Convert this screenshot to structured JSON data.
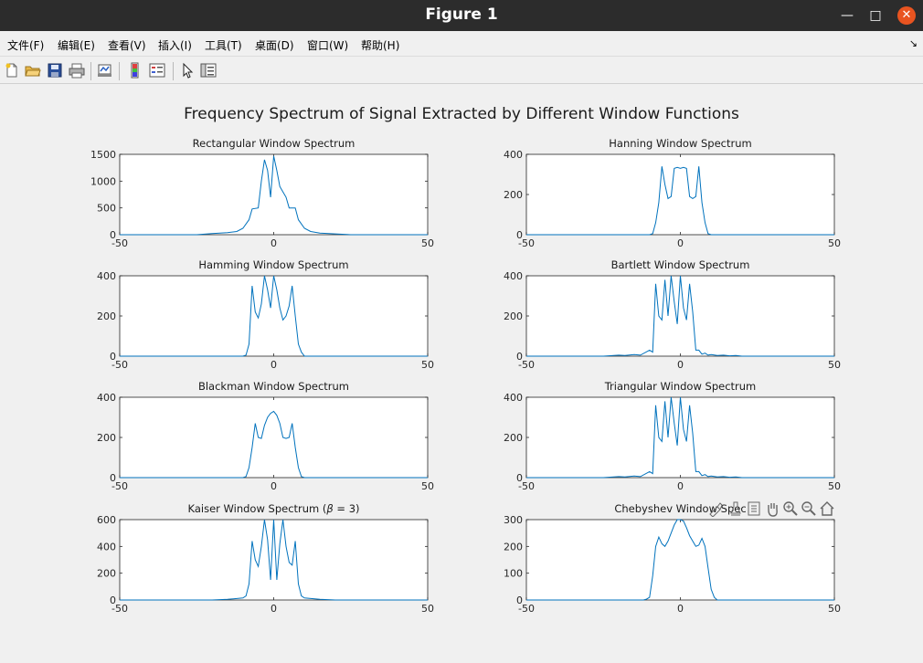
{
  "window": {
    "title": "Figure 1"
  },
  "menu": [
    "文件(F)",
    "编辑(E)",
    "查看(V)",
    "插入(I)",
    "工具(T)",
    "桌面(D)",
    "窗口(W)",
    "帮助(H)"
  ],
  "toolbar": [
    "new-figure-icon",
    "open-file-icon",
    "save-icon",
    "print-icon",
    "link-plot-icon",
    "colorbar-icon",
    "legend-icon",
    "edit-plot-arrow-icon",
    "property-inspector-icon"
  ],
  "axes_toolbar": [
    "brush-icon",
    "data-tips-icon",
    "restore-view-icon",
    "pan-icon",
    "zoom-in-icon",
    "zoom-out-icon",
    "home-icon"
  ],
  "figure": {
    "suptitle": "Frequency Spectrum of Signal Extracted by Different Window Functions",
    "line_color": "#0072bd"
  },
  "chart_data": [
    {
      "type": "line",
      "title": "Rectangular Window Spectrum",
      "xlim": [
        -50,
        50
      ],
      "ylim": [
        0,
        1500
      ],
      "xticks": [
        -50,
        0,
        50
      ],
      "yticks": [
        0,
        500,
        1000,
        1500
      ],
      "x": [
        -50,
        -25,
        -20,
        -15,
        -12,
        -10,
        -8,
        -7,
        -5,
        -4,
        -3,
        -2,
        -1,
        0,
        1,
        2,
        3,
        4,
        5,
        7,
        8,
        10,
        12,
        15,
        20,
        25,
        50
      ],
      "y": [
        0,
        0,
        20,
        40,
        60,
        120,
        280,
        480,
        500,
        1000,
        1400,
        1200,
        700,
        1470,
        1200,
        900,
        800,
        700,
        500,
        500,
        280,
        120,
        60,
        30,
        15,
        0,
        0
      ]
    },
    {
      "type": "line",
      "title": "Hanning Window Spectrum",
      "xlim": [
        -50,
        50
      ],
      "ylim": [
        0,
        400
      ],
      "xticks": [
        -50,
        0,
        50
      ],
      "yticks": [
        0,
        200,
        400
      ],
      "x": [
        -50,
        -10,
        -9,
        -8,
        -7,
        -6,
        -5,
        -4,
        -3,
        -2,
        -1,
        0,
        1,
        2,
        3,
        4,
        5,
        6,
        7,
        8,
        9,
        10,
        50
      ],
      "y": [
        0,
        0,
        5,
        60,
        160,
        340,
        250,
        180,
        190,
        330,
        335,
        330,
        335,
        330,
        190,
        180,
        190,
        340,
        160,
        60,
        5,
        0,
        0
      ]
    },
    {
      "type": "line",
      "title": "Hamming Window Spectrum",
      "xlim": [
        -50,
        50
      ],
      "ylim": [
        0,
        400
      ],
      "xticks": [
        -50,
        0,
        50
      ],
      "yticks": [
        0,
        200,
        400
      ],
      "x": [
        -50,
        -10,
        -9,
        -8,
        -7,
        -6,
        -5,
        -4,
        -3,
        -2,
        -1,
        0,
        1,
        2,
        3,
        4,
        5,
        6,
        7,
        8,
        9,
        10,
        50
      ],
      "y": [
        0,
        0,
        5,
        60,
        350,
        220,
        190,
        260,
        400,
        330,
        240,
        410,
        330,
        240,
        180,
        200,
        250,
        350,
        200,
        60,
        20,
        0,
        0
      ]
    },
    {
      "type": "line",
      "title": "Bartlett Window Spectrum",
      "xlim": [
        -50,
        50
      ],
      "ylim": [
        0,
        400
      ],
      "xticks": [
        -50,
        0,
        50
      ],
      "yticks": [
        0,
        200,
        400
      ],
      "x": [
        -50,
        -25,
        -20,
        -18,
        -15,
        -13,
        -10,
        -9,
        -8,
        -7,
        -6,
        -5,
        -4,
        -3,
        -2,
        -1,
        0,
        1,
        2,
        3,
        4,
        5,
        6,
        7,
        8,
        9,
        10,
        12,
        14,
        16,
        18,
        20,
        50
      ],
      "y": [
        0,
        0,
        5,
        3,
        8,
        5,
        30,
        20,
        360,
        200,
        180,
        380,
        200,
        400,
        270,
        160,
        400,
        240,
        180,
        360,
        220,
        30,
        30,
        10,
        15,
        5,
        8,
        3,
        5,
        2,
        3,
        0,
        0
      ]
    },
    {
      "type": "line",
      "title": "Blackman Window Spectrum",
      "xlim": [
        -50,
        50
      ],
      "ylim": [
        0,
        400
      ],
      "xticks": [
        -50,
        0,
        50
      ],
      "yticks": [
        0,
        200,
        400
      ],
      "x": [
        -50,
        -10,
        -9,
        -8,
        -7,
        -6,
        -5,
        -4,
        -3,
        -2,
        -1,
        0,
        1,
        2,
        3,
        4,
        5,
        6,
        7,
        8,
        9,
        10,
        50
      ],
      "y": [
        0,
        0,
        5,
        50,
        150,
        270,
        200,
        195,
        260,
        300,
        320,
        330,
        310,
        270,
        200,
        195,
        200,
        270,
        150,
        50,
        5,
        0,
        0
      ]
    },
    {
      "type": "line",
      "title": "Triangular Window Spectrum",
      "xlim": [
        -50,
        50
      ],
      "ylim": [
        0,
        400
      ],
      "xticks": [
        -50,
        0,
        50
      ],
      "yticks": [
        0,
        200,
        400
      ],
      "x": [
        -50,
        -25,
        -20,
        -18,
        -15,
        -13,
        -10,
        -9,
        -8,
        -7,
        -6,
        -5,
        -4,
        -3,
        -2,
        -1,
        0,
        1,
        2,
        3,
        4,
        5,
        6,
        7,
        8,
        9,
        10,
        12,
        14,
        16,
        18,
        20,
        50
      ],
      "y": [
        0,
        0,
        5,
        3,
        8,
        5,
        30,
        20,
        360,
        200,
        180,
        380,
        200,
        400,
        270,
        160,
        400,
        240,
        180,
        360,
        220,
        30,
        30,
        10,
        15,
        5,
        8,
        3,
        5,
        2,
        3,
        0,
        0
      ]
    },
    {
      "type": "line",
      "title": "Kaiser Window Spectrum (",
      "title_symbol": "β",
      "title_tail": " = 3)",
      "xlim": [
        -50,
        50
      ],
      "ylim": [
        0,
        600
      ],
      "xticks": [
        -50,
        0,
        50
      ],
      "yticks": [
        0,
        200,
        400,
        600
      ],
      "x": [
        -50,
        -20,
        -15,
        -10,
        -9,
        -8,
        -7,
        -6,
        -5,
        -4,
        -3,
        -2,
        -1,
        0,
        1,
        2,
        3,
        4,
        5,
        6,
        7,
        8,
        9,
        10,
        15,
        20,
        50
      ],
      "y": [
        0,
        0,
        5,
        15,
        30,
        120,
        440,
        300,
        250,
        400,
        600,
        450,
        150,
        620,
        150,
        420,
        600,
        400,
        280,
        260,
        440,
        120,
        30,
        15,
        5,
        0,
        0
      ]
    },
    {
      "type": "line",
      "title": "Chebyshev Window Spec",
      "xlim": [
        -50,
        50
      ],
      "ylim": [
        0,
        300
      ],
      "xticks": [
        -50,
        0,
        50
      ],
      "yticks": [
        0,
        100,
        200,
        300
      ],
      "x": [
        -50,
        -12,
        -11,
        -10,
        -9,
        -8,
        -7,
        -6,
        -5,
        -4,
        -3,
        -2,
        -1,
        0,
        1,
        2,
        3,
        4,
        5,
        6,
        7,
        8,
        9,
        10,
        11,
        12,
        50
      ],
      "y": [
        0,
        0,
        3,
        10,
        90,
        200,
        235,
        210,
        200,
        220,
        250,
        280,
        300,
        310,
        295,
        270,
        240,
        220,
        200,
        205,
        230,
        200,
        120,
        40,
        10,
        0,
        0
      ]
    }
  ]
}
